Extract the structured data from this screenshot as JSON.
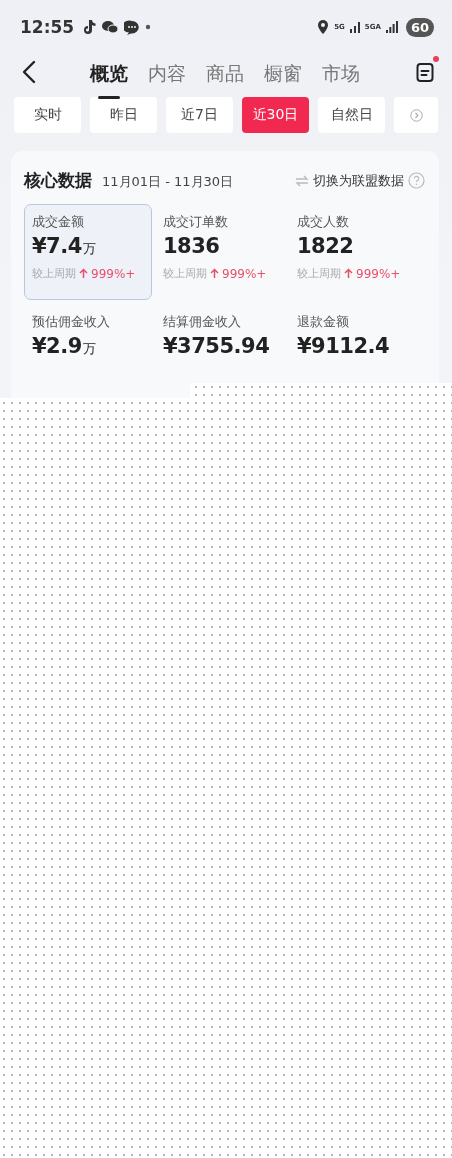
{
  "status_bar": {
    "time": "12:55",
    "network_1": "5G",
    "network_2": "5GA",
    "battery": "60"
  },
  "tabs": [
    {
      "label": "概览",
      "selected": true
    },
    {
      "label": "内容",
      "selected": false
    },
    {
      "label": "商品",
      "selected": false
    },
    {
      "label": "橱窗",
      "selected": false
    },
    {
      "label": "市场",
      "selected": false
    }
  ],
  "notification_dot": true,
  "periods": [
    {
      "label": "实时",
      "selected": false
    },
    {
      "label": "昨日",
      "selected": false
    },
    {
      "label": "近7日",
      "selected": false
    },
    {
      "label": "近30日",
      "selected": true
    },
    {
      "label": "自然日",
      "selected": false
    }
  ],
  "core_data": {
    "title": "核心数据",
    "date_range": "11月01日 - 11月30日",
    "switch_label": "切换为联盟数据",
    "metrics": [
      {
        "label": "成交金额",
        "value": "¥7.4",
        "unit": "万",
        "compare_label": "较上周期",
        "change": "999%+",
        "selected": true
      },
      {
        "label": "成交订单数",
        "value": "1836",
        "compare_label": "较上周期",
        "change": "999%+",
        "selected": false
      },
      {
        "label": "成交人数",
        "value": "1822",
        "compare_label": "较上周期",
        "change": "999%+",
        "selected": false
      },
      {
        "label": "预估佣金收入",
        "value": "¥2.9",
        "unit": "万",
        "selected": false
      },
      {
        "label": "结算佣金收入",
        "value": "¥3755.94",
        "selected": false
      },
      {
        "label": "退款金额",
        "value": "¥9112.4",
        "selected": false
      }
    ]
  }
}
